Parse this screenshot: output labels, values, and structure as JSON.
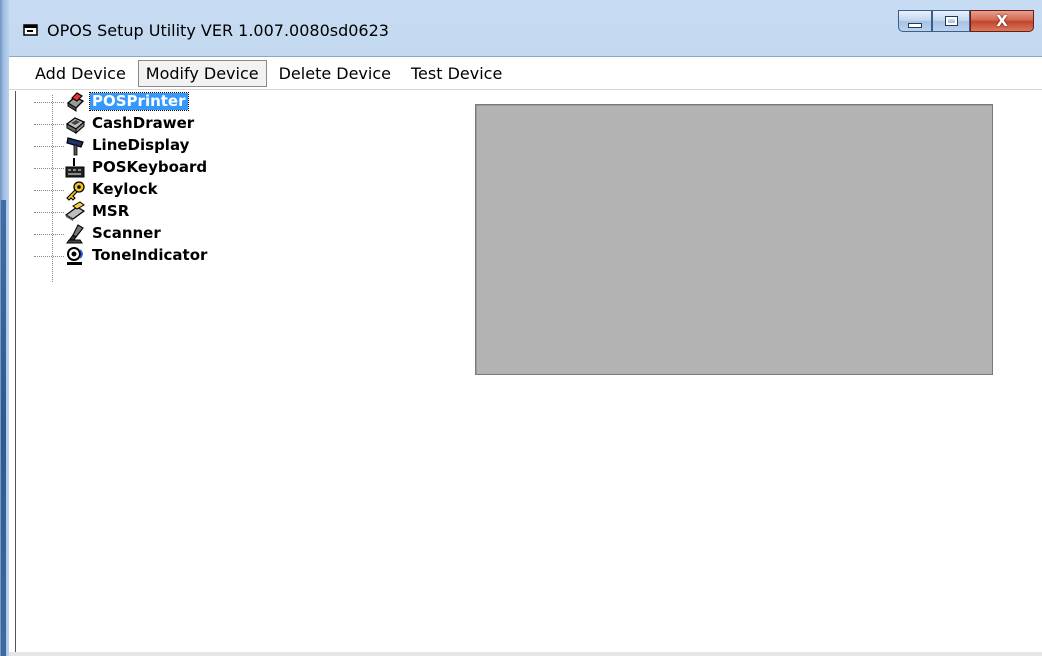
{
  "window": {
    "title": "OPOS Setup Utility VER 1.007.0080sd0623",
    "minimize_icon": "minimize-icon",
    "maximize_icon": "maximize-icon",
    "close_label": "X"
  },
  "menu": {
    "items": [
      {
        "label": "Add Device"
      },
      {
        "label": "Modify Device"
      },
      {
        "label": "Delete Device"
      },
      {
        "label": "Test Device"
      }
    ]
  },
  "tree": {
    "items": [
      {
        "label": "POSPrinter",
        "icon": "printer-icon",
        "selected": true
      },
      {
        "label": "CashDrawer",
        "icon": "cash-drawer-icon"
      },
      {
        "label": "LineDisplay",
        "icon": "line-display-icon"
      },
      {
        "label": "POSKeyboard",
        "icon": "keyboard-icon"
      },
      {
        "label": "Keylock",
        "icon": "key-icon"
      },
      {
        "label": "MSR",
        "icon": "card-reader-icon"
      },
      {
        "label": "Scanner",
        "icon": "scanner-icon"
      },
      {
        "label": "ToneIndicator",
        "icon": "speaker-icon"
      }
    ]
  },
  "colors": {
    "selection": "#3399ff",
    "preview_panel": "#b3b3b3",
    "close_button": "#c2452b"
  }
}
